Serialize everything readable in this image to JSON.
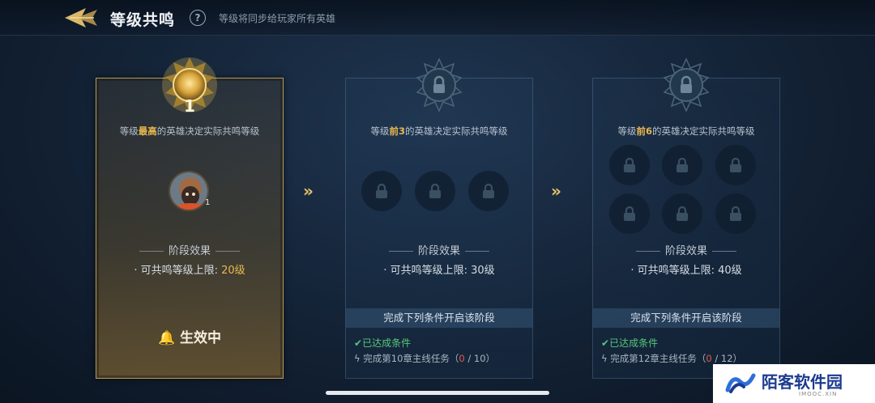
{
  "header": {
    "title": "等级共鸣",
    "help_symbol": "?",
    "subtitle": "等级将同步给玩家所有英雄"
  },
  "stages": [
    {
      "badge_number": "1",
      "desc_prefix": "等级",
      "desc_highlight": "最高",
      "desc_suffix": "的英雄决定实际共鸣等级",
      "hero_level": "1",
      "effect_title": "阶段效果",
      "effect_label": "· 可共鸣等级上限: ",
      "effect_value": "20级",
      "status": "生效中"
    },
    {
      "desc_prefix": "等级",
      "desc_highlight": "前3",
      "desc_suffix": "的英雄决定实际共鸣等级",
      "effect_title": "阶段效果",
      "effect_label": "· 可共鸣等级上限: ",
      "effect_value": "30级",
      "condition_header": "完成下列条件开启该阶段",
      "condition_ok": "已达成条件",
      "task_label": "完成第10章主线任务（",
      "task_progress": "0",
      "task_total": " / 10）"
    },
    {
      "desc_prefix": "等级",
      "desc_highlight": "前6",
      "desc_suffix": "的英雄决定实际共鸣等级",
      "effect_title": "阶段效果",
      "effect_label": "· 可共鸣等级上限: ",
      "effect_value": "40级",
      "condition_header": "完成下列条件开启该阶段",
      "condition_ok": "已达成条件",
      "task_label": "完成第12章主线任务（",
      "task_progress": "0",
      "task_total": " / 12）"
    }
  ],
  "arrows": "»",
  "watermark": {
    "text": "陌客软件园",
    "sub": "IMOOC.XIN"
  },
  "colors": {
    "accent_gold": "#e9b84e",
    "success_green": "#56c87a",
    "progress_red": "#e25b4b"
  }
}
